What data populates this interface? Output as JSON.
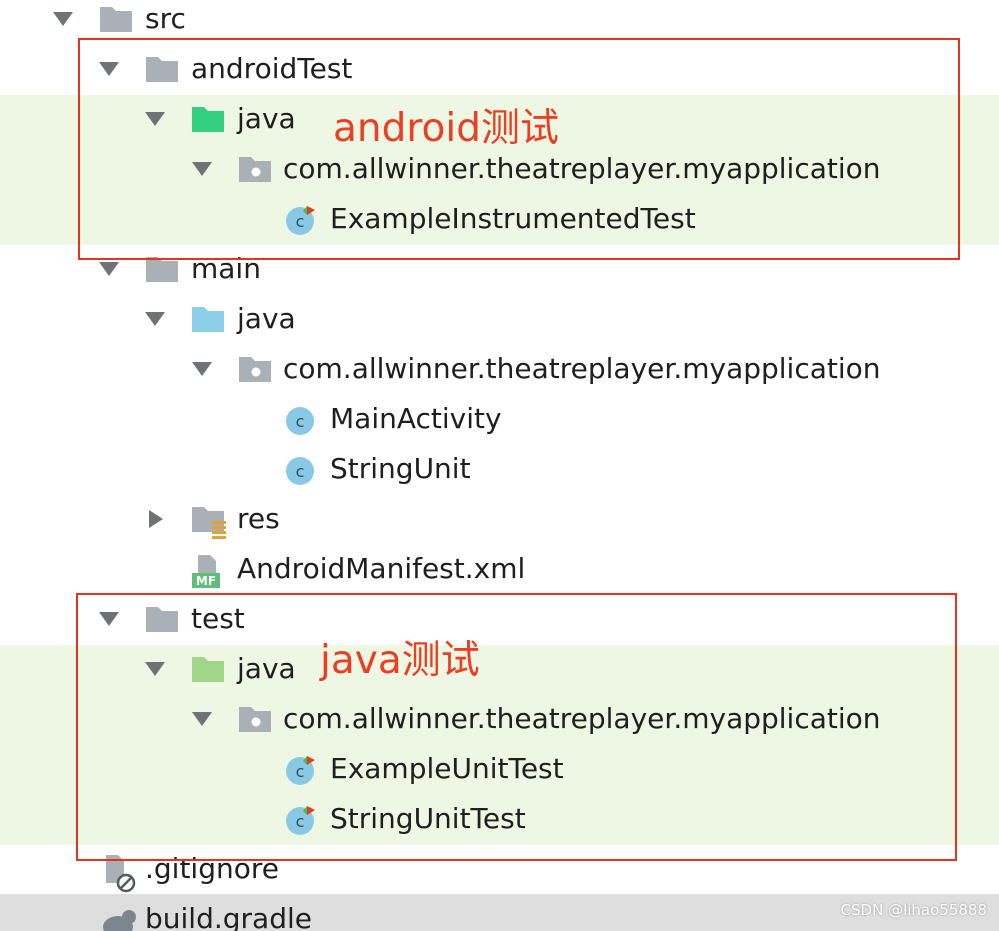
{
  "tree": {
    "rows": [
      {
        "label": "src",
        "kind": "folder",
        "expanded": true
      },
      {
        "label": "androidTest",
        "kind": "folder",
        "expanded": true
      },
      {
        "label": "java",
        "kind": "source-folder-test-android",
        "expanded": true
      },
      {
        "label": "com.allwinner.theatreplayer.myapplication",
        "kind": "package",
        "expanded": true
      },
      {
        "label": "ExampleInstrumentedTest",
        "kind": "test-class"
      },
      {
        "label": "main",
        "kind": "folder",
        "expanded": true
      },
      {
        "label": "java",
        "kind": "source-folder",
        "expanded": true
      },
      {
        "label": "com.allwinner.theatreplayer.myapplication",
        "kind": "package",
        "expanded": true
      },
      {
        "label": "MainActivity",
        "kind": "class"
      },
      {
        "label": "StringUnit",
        "kind": "class"
      },
      {
        "label": "res",
        "kind": "resource-folder",
        "expanded": false
      },
      {
        "label": "AndroidManifest.xml",
        "kind": "manifest-file"
      },
      {
        "label": "test",
        "kind": "folder",
        "expanded": true
      },
      {
        "label": "java",
        "kind": "source-folder-test",
        "expanded": true
      },
      {
        "label": "com.allwinner.theatreplayer.myapplication",
        "kind": "package",
        "expanded": true
      },
      {
        "label": "ExampleUnitTest",
        "kind": "test-class"
      },
      {
        "label": "StringUnitTest",
        "kind": "test-class"
      },
      {
        "label": ".gitignore",
        "kind": "ignored-file"
      },
      {
        "label": "build.gradle",
        "kind": "gradle-file"
      }
    ]
  },
  "icons": {
    "manifest_badge": "MF",
    "class_letter": "c"
  },
  "annotations": {
    "android_test": "android测试",
    "java_test": "java测试"
  },
  "watermark": "CSDN @lihao55888",
  "colors": {
    "highlight_band": "#eef7e4",
    "annotation_red": "#e53322",
    "folder_gray": "#a9b1b7",
    "class_blue": "#8ac9e6",
    "android_test_green": "#35d07f",
    "main_java_blue": "#8dcfe8",
    "test_java_green": "#9fd687"
  }
}
